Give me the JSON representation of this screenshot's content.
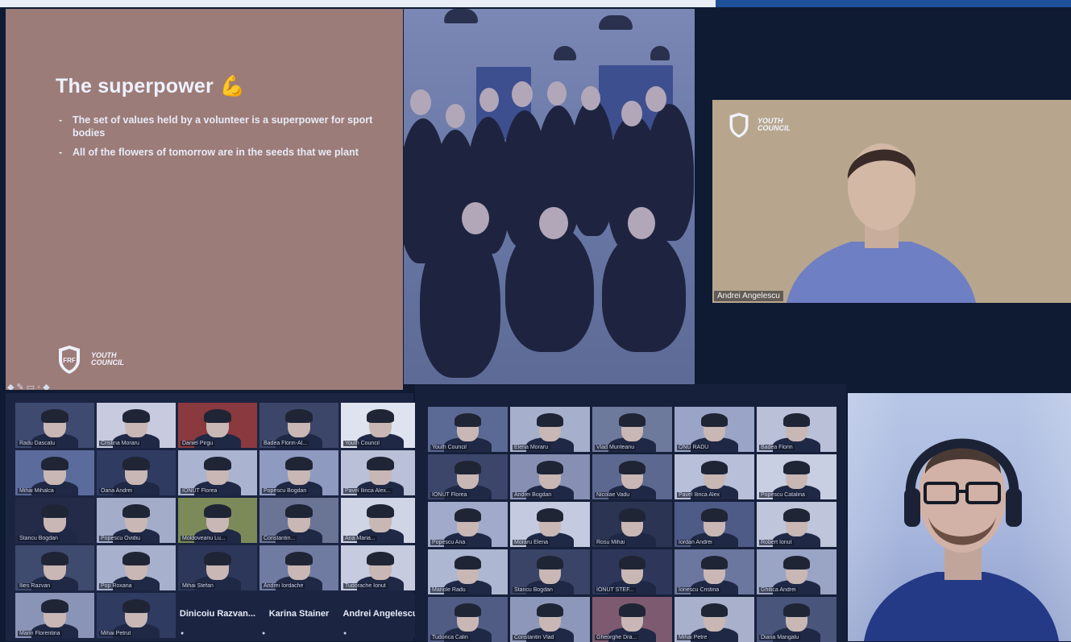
{
  "slide": {
    "title": "The superpower",
    "emoji": "💪",
    "bullets": [
      "The set of values held by a volunteer is a superpower for sport bodies",
      "All of the flowers of tomorrow are in the seeds that we plant"
    ],
    "logo_line1": "YOUTH",
    "logo_line2": "COUNCIL",
    "logo_badge": "FRF",
    "tools": "◆ ✎ ▭ ◦ ◆"
  },
  "speaker": {
    "name": "Andrei Angelescu",
    "logo_line1": "YOUTH",
    "logo_line2": "COUNCIL"
  },
  "left_grid": {
    "tiles": [
      {
        "label": "Radu Dascalu",
        "active": true,
        "hue": "#3e4a6f"
      },
      {
        "label": "Cristina Moraru",
        "hue": "#c8cbe0"
      },
      {
        "label": "Daniel Pirgu",
        "hue": "#8a3a3e"
      },
      {
        "label": "Badea Florin-Al...",
        "hue": "#3c4668"
      },
      {
        "label": "Youth Council",
        "hue": "#dfe3ef"
      },
      {
        "label": "Mihai Mihalca",
        "hue": "#5a6b9c"
      },
      {
        "label": "Oana Andrei",
        "hue": "#2f3b61"
      },
      {
        "label": "IONUT Florea",
        "hue": "#aab3cf"
      },
      {
        "label": "Popescu Bogdan",
        "hue": "#8e9ac0"
      },
      {
        "label": "Pavel Ilinca Alex...",
        "hue": "#b9c0d8"
      },
      {
        "label": "Stancu Bogdan",
        "hue": "#232b49"
      },
      {
        "label": "Popescu Ovidiu",
        "hue": "#a3acc9"
      },
      {
        "label": "Moldoveanu Lu...",
        "hue": "#7c8a5a"
      },
      {
        "label": "Constantin...",
        "hue": "#6a7596"
      },
      {
        "label": "Ana Maria...",
        "hue": "#d0d5e6"
      },
      {
        "label": "Ilies Razvan",
        "hue": "#3f4a6f"
      },
      {
        "label": "Pop Roxana",
        "hue": "#a7b0cc"
      },
      {
        "label": "Mihai Stefan",
        "hue": "#2d375a"
      },
      {
        "label": "Andrei Iordache",
        "hue": "#6f7ba0"
      },
      {
        "label": "Tudorache Ionut",
        "hue": "#c6cbe0"
      },
      {
        "label": "Marin Florentina",
        "hue": "#8a94b6"
      },
      {
        "label": "Mihai Petrut",
        "hue": "#2f3b61"
      }
    ],
    "name_tiles": [
      "Dinicoiu Razvan...",
      "Karina Stainer",
      "Andrei Angelescu"
    ]
  },
  "right_grid": {
    "tiles": [
      {
        "label": "Youth Council",
        "hue": "#5a6a94"
      },
      {
        "label": "Elena Moraru",
        "hue": "#a6afcc"
      },
      {
        "label": "Vlad Munteanu",
        "active": true,
        "hue": "#6e7a9c"
      },
      {
        "label": "ONU RADU",
        "hue": "#9aa4c6"
      },
      {
        "label": "Badea Florin",
        "hue": "#b9c0d8"
      },
      {
        "label": "IONUT Florea",
        "hue": "#3c466b"
      },
      {
        "label": "Andrei Bogdan",
        "hue": "#8790b3"
      },
      {
        "label": "Nicolae Vadu",
        "hue": "#5c6890"
      },
      {
        "label": "Pavel Ilinca Alex",
        "hue": "#b7bfd9"
      },
      {
        "label": "Popescu Catalina",
        "hue": "#c9cfe3"
      },
      {
        "label": "Popescu Ana",
        "hue": "#a1aaca"
      },
      {
        "label": "Moraru Elena",
        "hue": "#c4cbe0"
      },
      {
        "label": "Rosu Mihai",
        "hue": "#2b3453"
      },
      {
        "label": "Iordan Andrei",
        "hue": "#4e5b86"
      },
      {
        "label": "Robert Ionut",
        "hue": "#bfc6dc"
      },
      {
        "label": "Manole Radu",
        "hue": "#aeb7d1"
      },
      {
        "label": "Stancu Bogdan",
        "hue": "#3a4466"
      },
      {
        "label": "IONUT STEF...",
        "hue": "#2e375a"
      },
      {
        "label": "Ionescu Cristina",
        "hue": "#6c77a0"
      },
      {
        "label": "Ghitica Andrei",
        "hue": "#9aa4c4"
      },
      {
        "label": "Tudorica Calin",
        "hue": "#505c84"
      },
      {
        "label": "Constantin Vlad",
        "hue": "#8d97b9"
      },
      {
        "label": "Gheorghe Dra...",
        "hue": "#7d5a70"
      },
      {
        "label": "Mihai Petre",
        "hue": "#a8b0cc"
      },
      {
        "label": "Diana Mangalu",
        "hue": "#4a557b"
      }
    ]
  }
}
